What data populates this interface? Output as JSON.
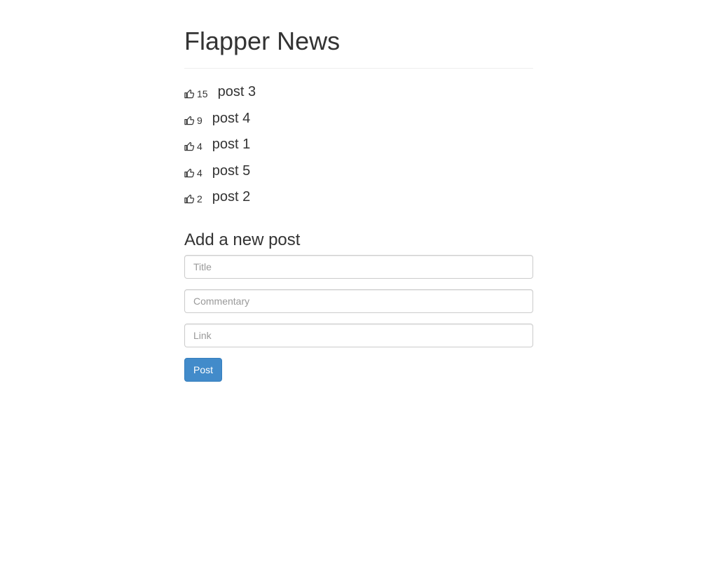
{
  "header": {
    "title": "Flapper News"
  },
  "posts": [
    {
      "upvotes": "15",
      "title": "post 3"
    },
    {
      "upvotes": "9",
      "title": "post 4"
    },
    {
      "upvotes": "4",
      "title": "post 1"
    },
    {
      "upvotes": "4",
      "title": "post 5"
    },
    {
      "upvotes": "2",
      "title": "post 2"
    }
  ],
  "form": {
    "heading": "Add a new post",
    "title_placeholder": "Title",
    "title_value": "",
    "commentary_placeholder": "Commentary",
    "commentary_value": "",
    "link_placeholder": "Link",
    "link_value": "",
    "submit_label": "Post"
  },
  "icons": {
    "upvote": "thumbs-up-icon"
  },
  "colors": {
    "primary_button": "#428bca",
    "text": "#333333",
    "divider": "#eeeeee"
  }
}
